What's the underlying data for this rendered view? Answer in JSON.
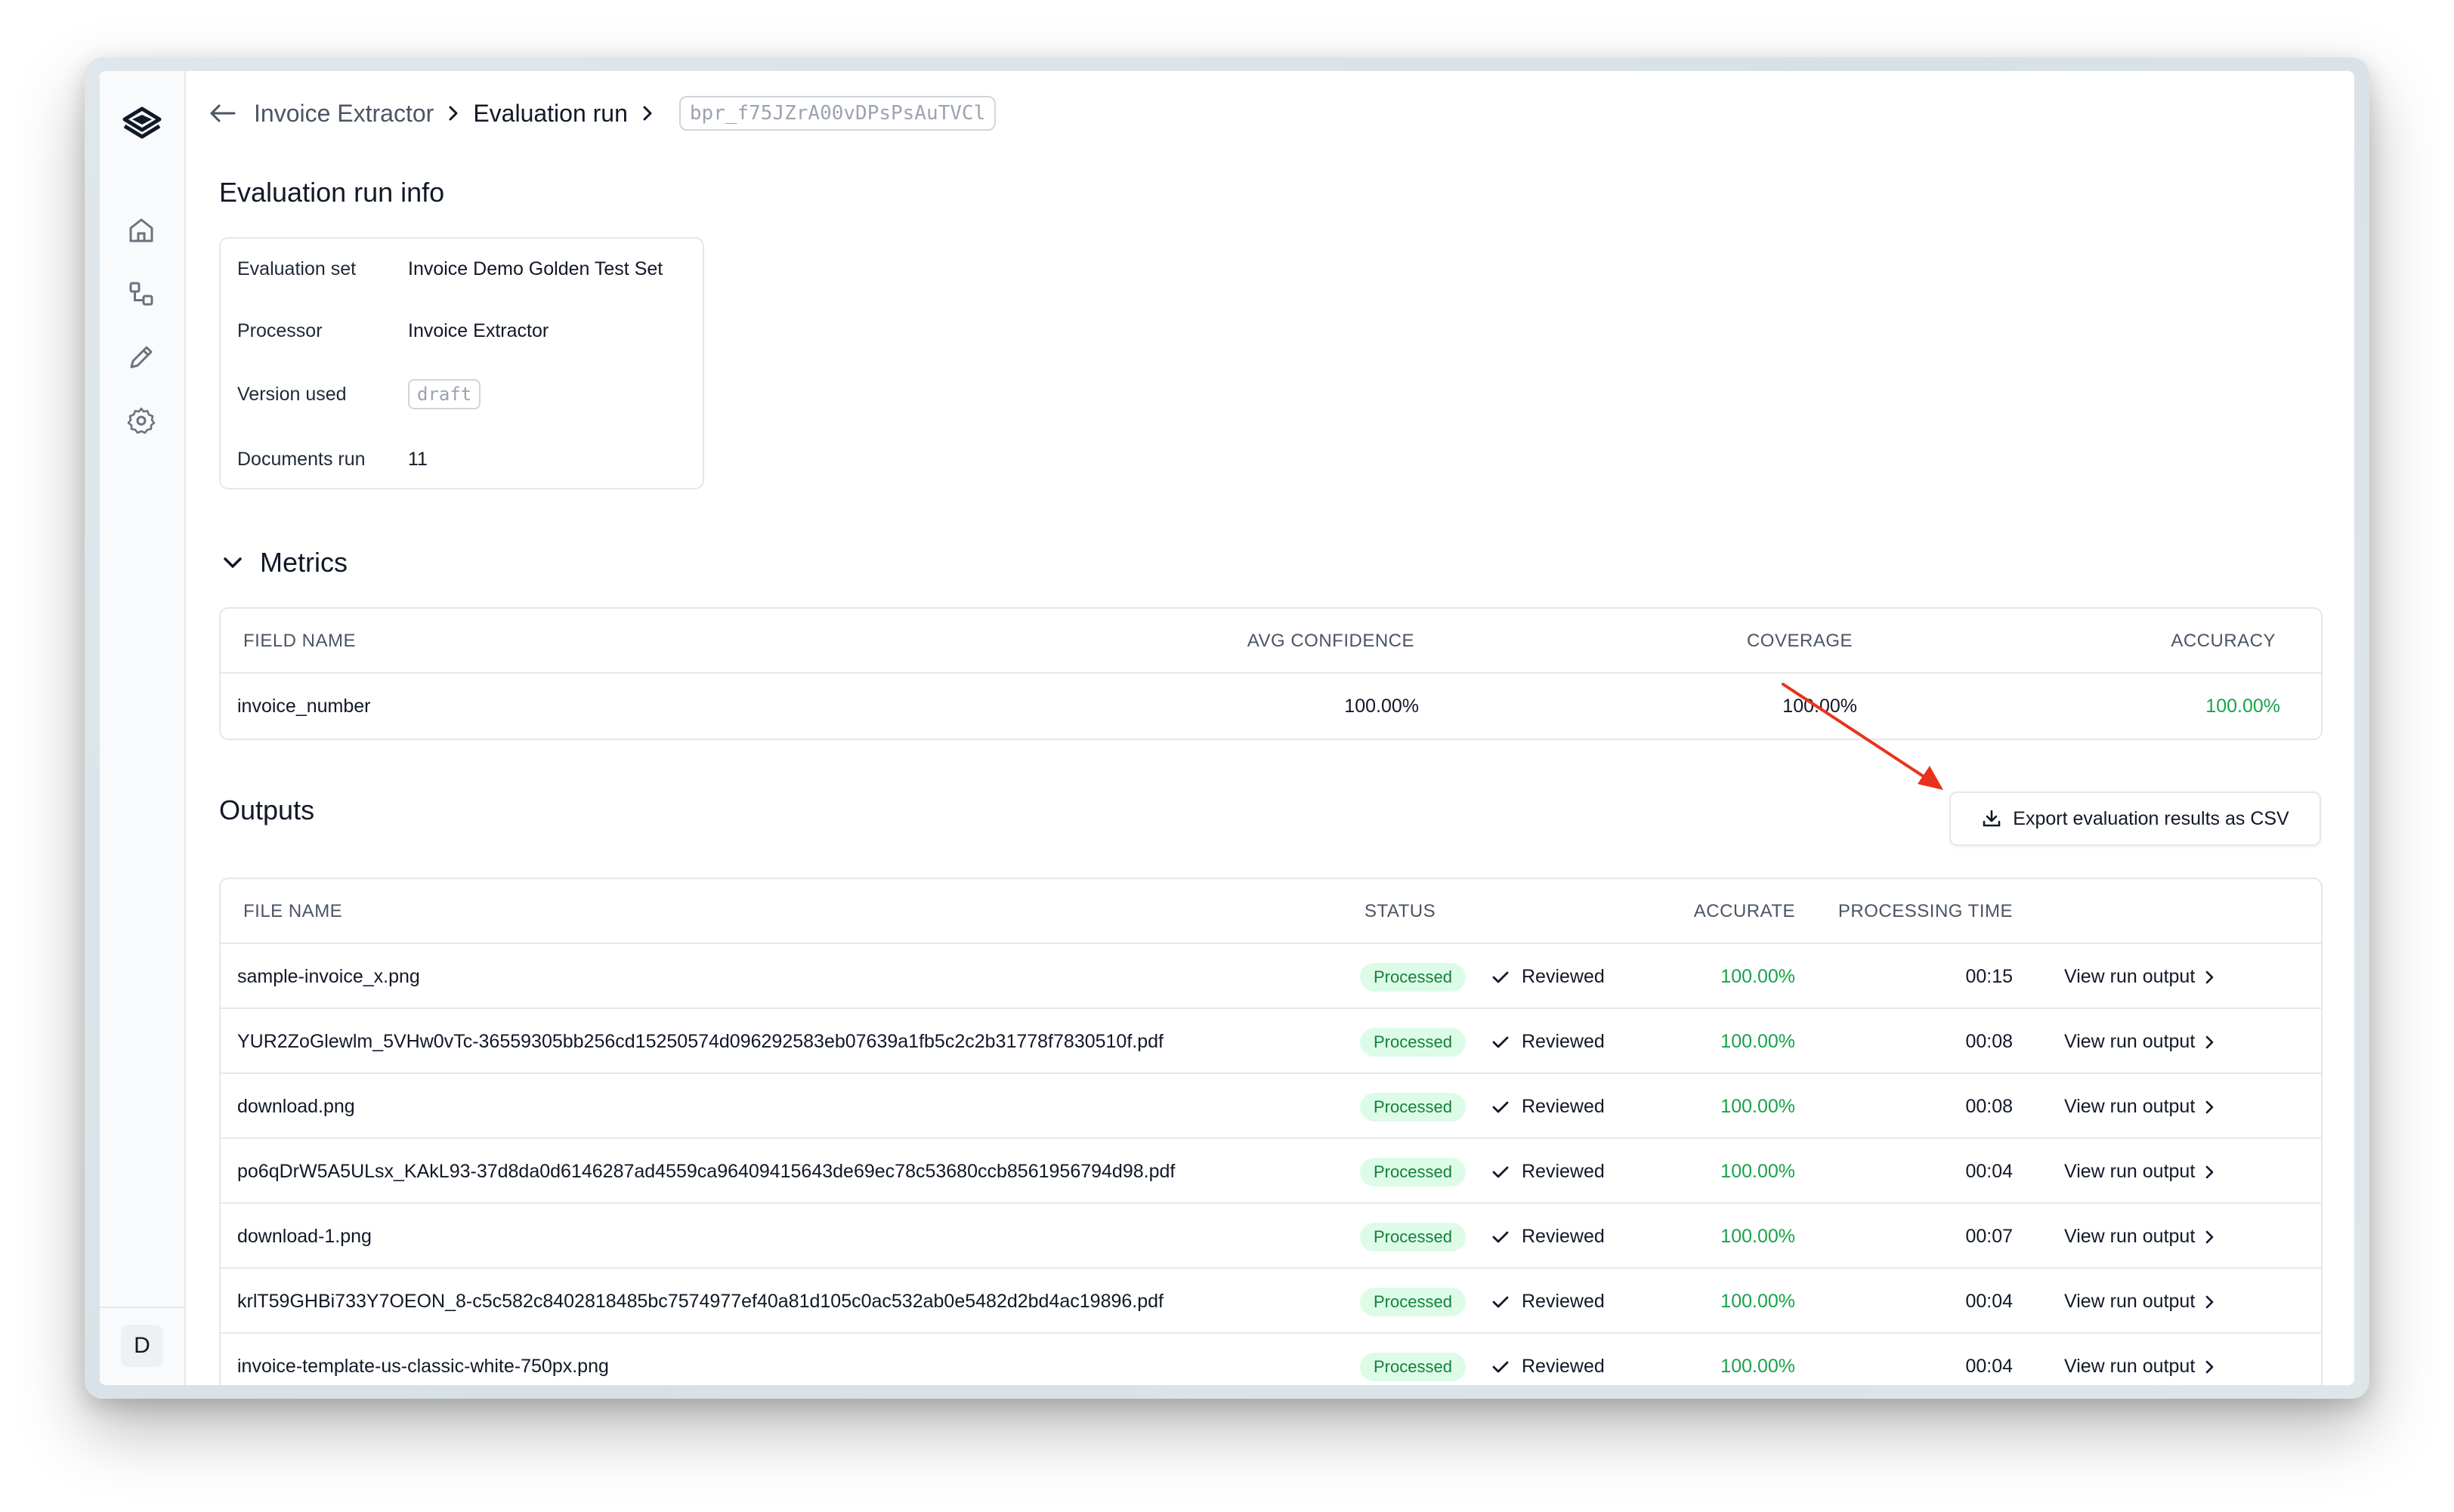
{
  "breadcrumb": {
    "processor": "Invoice Extractor",
    "section": "Evaluation run",
    "run_id": "bpr_f75JZrA00vDPsPsAuTVCl"
  },
  "sidebar": {
    "avatar_initial": "D",
    "icons": [
      "logo-icon",
      "home-icon",
      "workflow-icon",
      "pencil-icon",
      "settings-icon"
    ]
  },
  "info": {
    "title": "Evaluation run info",
    "rows": [
      {
        "label": "Evaluation set",
        "value": "Invoice Demo Golden Test Set"
      },
      {
        "label": "Processor",
        "value": "Invoice Extractor"
      },
      {
        "label": "Version used",
        "value": "draft"
      },
      {
        "label": "Documents run",
        "value": "11"
      }
    ]
  },
  "metrics": {
    "title": "Metrics",
    "columns": [
      "FIELD NAME",
      "AVG CONFIDENCE",
      "COVERAGE",
      "ACCURACY"
    ],
    "rows": [
      {
        "field": "invoice_number",
        "avg_confidence": "100.00%",
        "coverage": "100.00%",
        "accuracy": "100.00%"
      }
    ]
  },
  "outputs": {
    "title": "Outputs",
    "export_label": "Export evaluation results as CSV",
    "columns": [
      "FILE NAME",
      "STATUS",
      "ACCURATE",
      "PROCESSING TIME"
    ],
    "rows": [
      {
        "file": "sample-invoice_x.png",
        "status": "Processed",
        "review": "Reviewed",
        "accurate": "100.00%",
        "time": "00:15",
        "link": "View run output"
      },
      {
        "file": "YUR2ZoGlewlm_5VHw0vTc-36559305bb256cd15250574d096292583eb07639a1fb5c2c2b31778f7830510f.pdf",
        "status": "Processed",
        "review": "Reviewed",
        "accurate": "100.00%",
        "time": "00:08",
        "link": "View run output"
      },
      {
        "file": "download.png",
        "status": "Processed",
        "review": "Reviewed",
        "accurate": "100.00%",
        "time": "00:08",
        "link": "View run output"
      },
      {
        "file": "po6qDrW5A5ULsx_KAkL93-37d8da0d6146287ad4559ca96409415643de69ec78c53680ccb8561956794d98.pdf",
        "status": "Processed",
        "review": "Reviewed",
        "accurate": "100.00%",
        "time": "00:04",
        "link": "View run output"
      },
      {
        "file": "download-1.png",
        "status": "Processed",
        "review": "Reviewed",
        "accurate": "100.00%",
        "time": "00:07",
        "link": "View run output"
      },
      {
        "file": "krlT59GHBi733Y7OEON_8-c5c582c8402818485bc7574977ef40a81d105c0ac532ab0e5482d2bd4ac19896.pdf",
        "status": "Processed",
        "review": "Reviewed",
        "accurate": "100.00%",
        "time": "00:04",
        "link": "View run output"
      },
      {
        "file": "invoice-template-us-classic-white-750px.png",
        "status": "Processed",
        "review": "Reviewed",
        "accurate": "100.00%",
        "time": "00:04",
        "link": "View run output"
      }
    ]
  },
  "colors": {
    "accent_green": "#16a34a",
    "badge_bg": "#dcfce7",
    "annotation_arrow": "#e8321f"
  }
}
